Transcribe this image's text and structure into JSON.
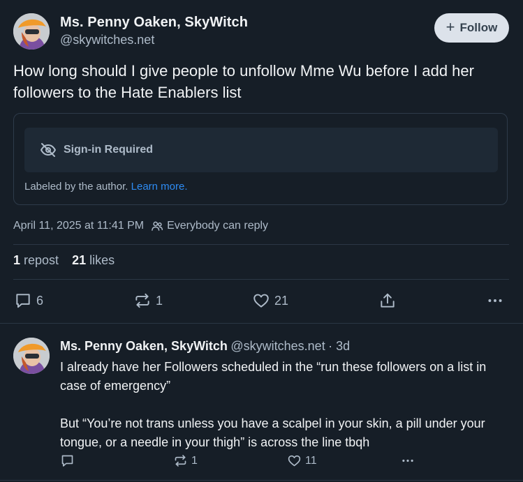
{
  "post": {
    "author_name": "Ms. Penny Oaken, SkyWitch",
    "author_handle": "@skywitches.net",
    "follow_label": "Follow",
    "text": "How long should I give people to unfollow Mme Wu before I add her followers to the Hate Enablers list",
    "label_title": "Sign-in Required",
    "labeled_text": "Labeled by the author.",
    "learn_more": "Learn more.",
    "timestamp": "April 11, 2025 at 11:41 PM",
    "reply_setting": "Everybody can reply",
    "reposts_count": "1",
    "reposts_label": "repost",
    "likes_count": "21",
    "likes_label": "likes",
    "actions": {
      "replies": "6",
      "reposts": "1",
      "likes": "21"
    }
  },
  "reply": {
    "author_name": "Ms. Penny Oaken, SkyWitch",
    "author_handle": "@skywitches.net",
    "age": "· 3d",
    "paragraph1": "I already have her Followers scheduled in the “run these followers on a list in case of emergency”",
    "paragraph2": "But “You’re not trans unless you have a scalpel in your skin, a pill under your tongue, or a needle in your thigh” is across the line tbqh",
    "actions": {
      "reposts": "1",
      "likes": "11"
    }
  },
  "colors": {
    "background": "#161e27",
    "accent": "#2e8cf3",
    "muted": "#aebbc9"
  },
  "icons": [
    "eye-slash-icon",
    "people-icon",
    "comment-icon",
    "repost-icon",
    "heart-icon",
    "share-icon",
    "more-icon",
    "plus-icon"
  ]
}
